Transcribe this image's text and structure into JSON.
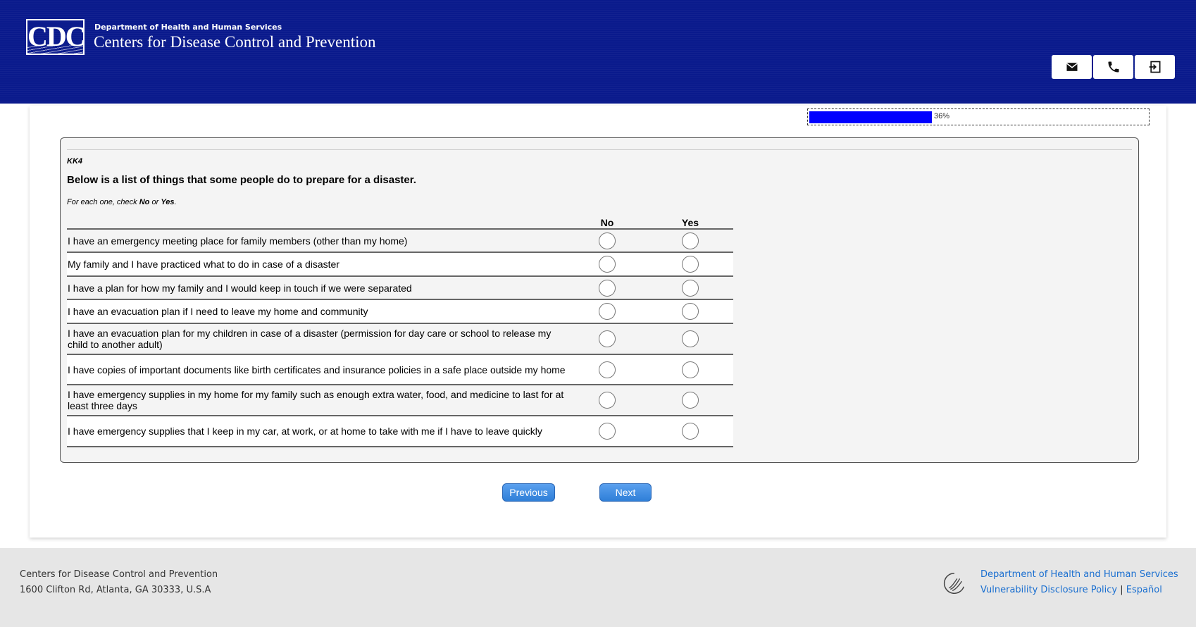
{
  "header": {
    "logo_text": "CDC",
    "department": "Department of Health and Human Services",
    "title": "Centers for Disease Control and Prevention",
    "buttons": [
      {
        "icon": "mail-icon"
      },
      {
        "icon": "phone-icon"
      },
      {
        "icon": "exit-icon"
      }
    ]
  },
  "progress": {
    "percent": 36,
    "label": "36%",
    "fill_color": "#0000ff"
  },
  "question": {
    "code": "KK4",
    "prompt": "Below is a list of things that some people do to prepare for a disaster.",
    "instruction_pre": "For each one, check ",
    "instruction_no": "No",
    "instruction_mid": " or ",
    "instruction_yes": "Yes",
    "instruction_post": ".",
    "columns": [
      "No",
      "Yes"
    ],
    "items": [
      "I have an emergency meeting place for family members (other than my home)",
      "My family and I have practiced what to do in case of a disaster",
      "I have a plan for how my family and I would keep in touch if we were separated",
      "I have an evacuation plan if I need to leave my home and community",
      "I have an evacuation plan for my children in case of a disaster (permission for day care or school to release my child to another adult)",
      "I have copies of important documents like birth certificates and insurance policies in a safe place outside my home",
      "I have emergency supplies in my home for my family such as enough extra water, food, and medicine to last for at least three days",
      "I have emergency supplies that I keep in my car, at work, or at home to take with me if I have to leave quickly"
    ]
  },
  "navigation": {
    "previous_label": "Previous",
    "next_label": "Next"
  },
  "footer": {
    "org": "Centers for Disease Control and Prevention",
    "address": "1600 Clifton Rd, Atlanta, GA 30333, U.S.A",
    "hhs_link": "Department of Health and Human Services",
    "vdp_link": "Vulnerability Disclosure Policy",
    "separator": "|",
    "espanol_link": "Español",
    "link_color": "#1a6fd0"
  }
}
